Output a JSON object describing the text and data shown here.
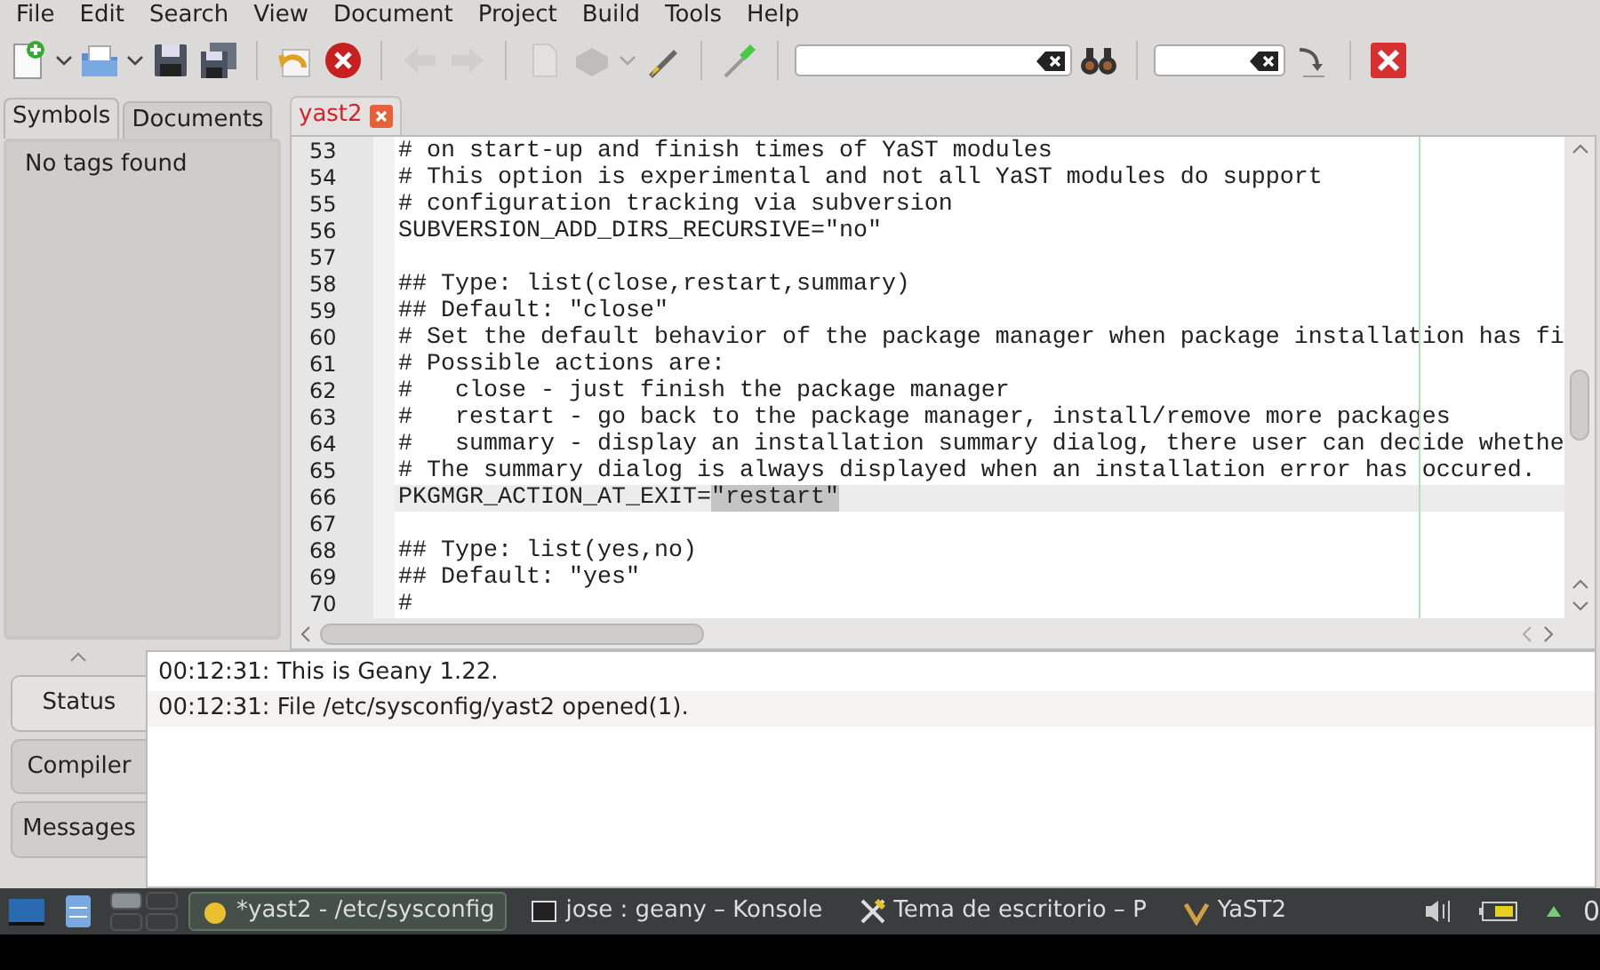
{
  "menu": [
    "File",
    "Edit",
    "Search",
    "View",
    "Document",
    "Project",
    "Build",
    "Tools",
    "Help"
  ],
  "toolbar": [
    {
      "kind": "button",
      "dropdown": true,
      "disabled": false
    },
    {
      "kind": "button",
      "dropdown": true,
      "disabled": false
    },
    {
      "kind": "button",
      "dropdown": false,
      "disabled": false
    },
    {
      "kind": "button",
      "dropdown": false,
      "disabled": false
    },
    {
      "kind": "separator"
    },
    {
      "kind": "button",
      "dropdown": false,
      "disabled": false
    },
    {
      "kind": "button",
      "dropdown": false,
      "disabled": false
    },
    {
      "kind": "separator"
    },
    {
      "kind": "button",
      "dropdown": false,
      "disabled": true
    },
    {
      "kind": "button",
      "dropdown": false,
      "disabled": true
    },
    {
      "kind": "separator"
    },
    {
      "kind": "button",
      "dropdown": false,
      "disabled": true
    },
    {
      "kind": "button",
      "dropdown": true,
      "disabled": true
    },
    {
      "kind": "button",
      "dropdown": false,
      "disabled": false
    },
    {
      "kind": "separator"
    },
    {
      "kind": "button",
      "dropdown": false,
      "disabled": false
    },
    {
      "kind": "separator"
    },
    {
      "kind": "field",
      "wide": true
    },
    {
      "kind": "button",
      "dropdown": false,
      "disabled": false
    },
    {
      "kind": "separator"
    },
    {
      "kind": "field",
      "wide": false
    },
    {
      "kind": "button",
      "dropdown": false,
      "disabled": false
    },
    {
      "kind": "separator"
    },
    {
      "kind": "button",
      "dropdown": false,
      "disabled": false
    }
  ],
  "sidebar": {
    "tabs": [
      {
        "label": "Symbols",
        "selected": true
      },
      {
        "label": "Documents",
        "selected": false
      }
    ],
    "message": "No tags found"
  },
  "editor": {
    "tabs": [
      {
        "label": "yast2",
        "modified": true
      }
    ],
    "lines": [
      {
        "number": "53",
        "text": "# on start-up and finish times of YaST modules",
        "current": false
      },
      {
        "number": "54",
        "text": "# This option is experimental and not all YaST modules do support",
        "current": false
      },
      {
        "number": "55",
        "text": "# configuration tracking via subversion",
        "current": false
      },
      {
        "number": "56",
        "text": "SUBVERSION_ADD_DIRS_RECURSIVE=\"no\"",
        "current": false
      },
      {
        "number": "57",
        "current": false
      },
      {
        "number": "58",
        "text": "## Type: list(close,restart,summary)",
        "current": false
      },
      {
        "number": "59",
        "text": "## Default: \"close\"",
        "current": false
      },
      {
        "number": "60",
        "text": "# Set the default behavior of the package manager when package installation has fi",
        "current": false
      },
      {
        "number": "61",
        "text": "# Possible actions are:",
        "current": false
      },
      {
        "number": "62",
        "text": "#   close - just finish the package manager",
        "current": false
      },
      {
        "number": "63",
        "text": "#   restart - go back to the package manager, install/remove more packages",
        "current": false
      },
      {
        "number": "64",
        "text": "#   summary - display an installation summary dialog, there user can decide whethe",
        "current": false
      },
      {
        "number": "65",
        "text": "# The summary dialog is always displayed when an installation error has occured.",
        "current": false
      },
      {
        "number": "66",
        "text": "PKGMGR_ACTION_AT_EXIT=",
        "selection": "\"restart\"",
        "current": true
      },
      {
        "number": "67",
        "current": false
      },
      {
        "number": "68",
        "text": "## Type: list(yes,no)",
        "current": false
      },
      {
        "number": "69",
        "text": "## Default: \"yes\"",
        "current": false
      },
      {
        "number": "70",
        "text": "#",
        "current": false
      }
    ]
  },
  "messages": {
    "tabs": [
      {
        "label": "Status",
        "selected": true
      },
      {
        "label": "Compiler",
        "selected": false
      },
      {
        "label": "Messages",
        "selected": false
      }
    ],
    "lines": [
      "00:12:31: This is Geany 1.22.",
      "00:12:31: File /etc/sysconfig/yast2 opened(1)."
    ]
  },
  "taskbar": {
    "desktops": [
      {
        "selected": true
      },
      {
        "selected": false
      },
      {
        "selected": false
      },
      {
        "selected": false
      }
    ],
    "tasks": [
      {
        "label": "*yast2 - /etc/sysconfig",
        "selected": true
      },
      {
        "label": "jose : geany – Konsole",
        "selected": false
      },
      {
        "label": "Tema de escritorio – P",
        "selected": false
      },
      {
        "label": "YaST2",
        "selected": false
      }
    ],
    "clock": "0"
  }
}
